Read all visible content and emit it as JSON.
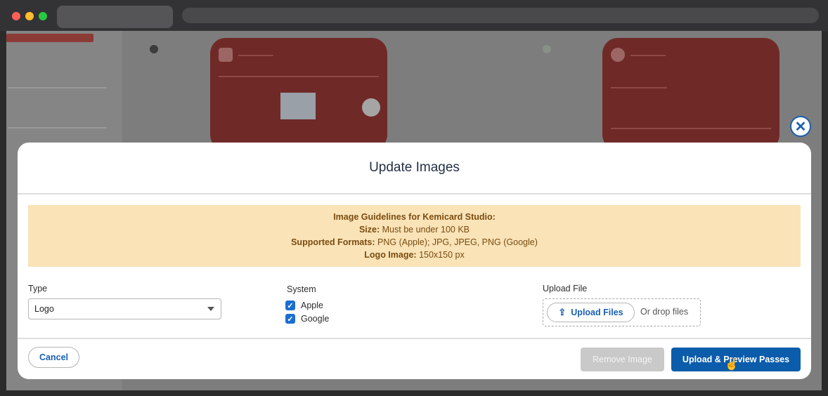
{
  "modal": {
    "title": "Update Images",
    "close_glyph": "✕",
    "guidelines": {
      "heading": "Image Guidelines for Kemicard Studio:",
      "size_label": "Size:",
      "size_value": "Must be under 100 KB",
      "formats_label": "Supported Formats:",
      "formats_value": "PNG (Apple); JPG, JPEG, PNG (Google)",
      "logo_label": "Logo Image:",
      "logo_value": "150x150 px"
    },
    "type": {
      "label": "Type",
      "selected": "Logo"
    },
    "system": {
      "label": "System",
      "options": [
        {
          "label": "Apple",
          "checked": true
        },
        {
          "label": "Google",
          "checked": true
        }
      ]
    },
    "upload": {
      "label": "Upload File",
      "button_label": "Upload Files",
      "drop_text": "Or drop files"
    },
    "footer": {
      "cancel_label": "Cancel",
      "remove_label": "Remove Image",
      "primary_label": "Upload & Preview Passes"
    }
  },
  "icons": {
    "close": "close-icon",
    "upload": "upload-icon",
    "caret": "chevron-down-icon",
    "check": "check-icon"
  },
  "colors": {
    "accent": "#0b5cab",
    "banner_bg": "#f9e3b7",
    "banner_text": "#7b4c10",
    "disabled_button": "#c9c9c9"
  }
}
